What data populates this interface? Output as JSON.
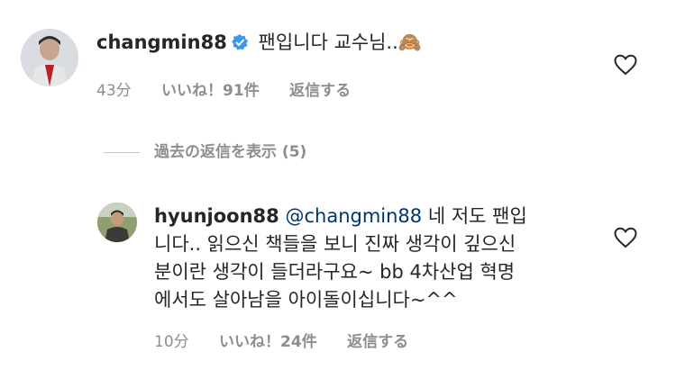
{
  "comment": {
    "username": "changmin88",
    "text": "팬입니다 교수님..🙈",
    "time": "43分",
    "likes": "いいね！91件",
    "reply": "返信する"
  },
  "view_replies": "過去の返信を表示 (5)",
  "reply": {
    "username": "hyunjoon88",
    "mention": "@changmin88",
    "line1_text": " 네 저도 팬입",
    "line2": "니다.. 읽으신 책들을 보니 진짜 생각이 깊으신",
    "line3": "분이란 생각이 들더라구요~ bb 4차산업 혁명",
    "line4": "에서도 살아남을 아이돌이십니다~^^",
    "time": "10分",
    "likes": "いいね！24件",
    "reply_label": "返信する"
  },
  "colors": {
    "verified": "#3897f0",
    "meta": "#8e8e8e",
    "mention": "#003569"
  },
  "icons": [
    "verified-badge-icon",
    "heart-icon"
  ]
}
